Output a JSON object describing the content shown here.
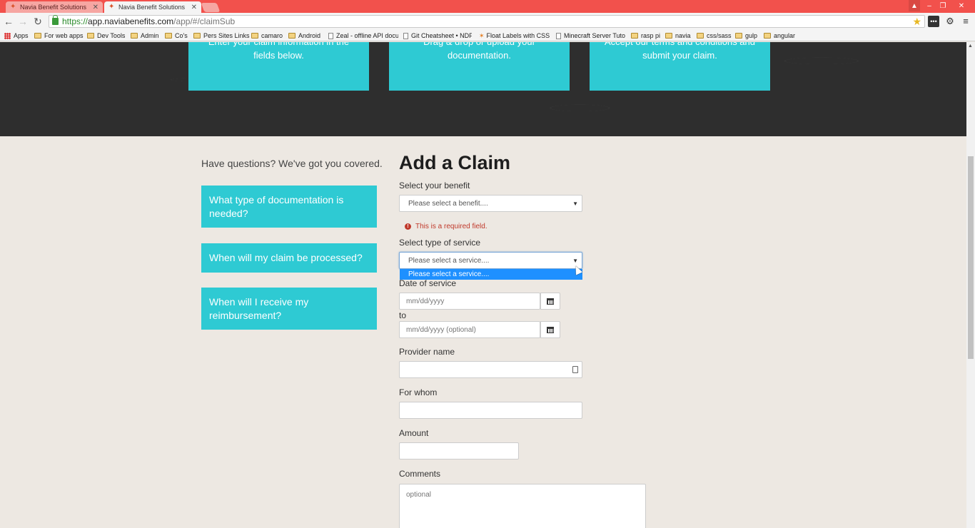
{
  "browser": {
    "tabs": [
      {
        "title": "Navia Benefit Solutions",
        "active": false
      },
      {
        "title": "Navia Benefit Solutions",
        "active": true
      }
    ],
    "url": {
      "scheme": "https://",
      "host": "app.naviabenefits.com",
      "path": "/app/#/claimSub"
    },
    "bookmarks": [
      {
        "label": "Apps",
        "type": "apps"
      },
      {
        "label": "For web apps",
        "type": "folder"
      },
      {
        "label": "Dev Tools",
        "type": "folder"
      },
      {
        "label": "Admin",
        "type": "folder"
      },
      {
        "label": "Co's",
        "type": "folder"
      },
      {
        "label": "Pers Sites Links",
        "type": "folder"
      },
      {
        "label": "camaro",
        "type": "folder"
      },
      {
        "label": "Android",
        "type": "folder"
      },
      {
        "label": "Zeal - offline API docu",
        "type": "page"
      },
      {
        "label": "Git Cheatsheet • NDP",
        "type": "page"
      },
      {
        "label": "Float Labels with CSS",
        "type": "page"
      },
      {
        "label": "Minecraft Server Tuto",
        "type": "page"
      },
      {
        "label": "rasp pi",
        "type": "folder"
      },
      {
        "label": "navia",
        "type": "folder"
      },
      {
        "label": "css/sass",
        "type": "folder"
      },
      {
        "label": "gulp",
        "type": "folder"
      },
      {
        "label": "angular",
        "type": "folder"
      }
    ]
  },
  "steps": [
    {
      "text": "Enter your claim information in the fields below."
    },
    {
      "text": "Drag & drop or upload your documentation."
    },
    {
      "text": "Accept our terms and conditions and submit your claim."
    }
  ],
  "faq": {
    "intro": "Have questions? We've got you covered.",
    "items": [
      "What type of documentation is needed?",
      "When will my claim be processed?",
      "When will I receive my reimbursement?"
    ]
  },
  "form": {
    "title": "Add a Claim",
    "benefit": {
      "label": "Select your benefit",
      "value": "Please select a benefit....",
      "error": "This is a required field."
    },
    "service": {
      "label": "Select type of service",
      "value": "Please select a service....",
      "options": [
        "Please select a service...."
      ]
    },
    "date": {
      "label": "Date of service",
      "from_placeholder": "mm/dd/yyyy",
      "to_label": "to",
      "to_placeholder": "mm/dd/yyyy (optional)"
    },
    "provider": {
      "label": "Provider name"
    },
    "for_whom": {
      "label": "For whom"
    },
    "amount": {
      "label": "Amount"
    },
    "comments": {
      "label": "Comments",
      "placeholder": "optional"
    }
  },
  "colors": {
    "accent": "#2ecad3",
    "hero_bg": "#2e2e2e",
    "page_bg": "#ede8e2",
    "error": "#c0392b",
    "tab_strip": "#f2514c"
  }
}
